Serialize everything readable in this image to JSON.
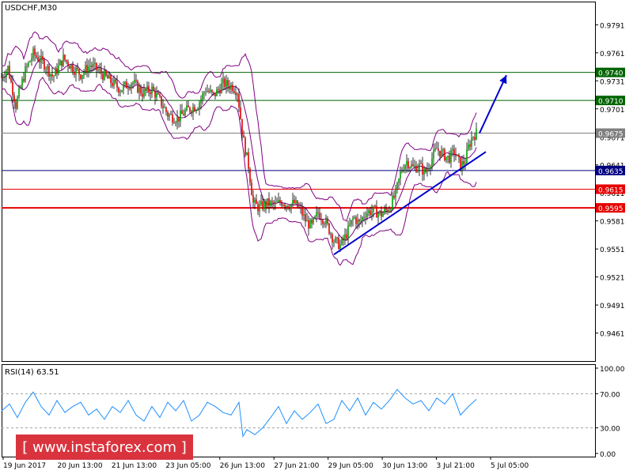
{
  "chart_data": [
    {
      "type": "candlestick",
      "title": "USDCHF,M30",
      "symbol": "USDCHF",
      "timeframe": "M30",
      "ylim": [
        0.9431,
        0.9815
      ],
      "y_ticks": [
        "0.9791",
        "0.9761",
        "0.9731",
        "0.9701",
        "0.9671",
        "0.9641",
        "0.9611",
        "0.9581",
        "0.9551",
        "0.9521",
        "0.9491",
        "0.9461"
      ],
      "x_ticks": [
        "19 Jun 2017",
        "20 Jun 13:00",
        "21 Jun 13:00",
        "23 Jun 05:00",
        "26 Jun 13:00",
        "27 Jun 21:00",
        "29 Jun 05:00",
        "30 Jun 13:00",
        "3 Jul 21:00",
        "5 Jul 05:00"
      ],
      "overlays": [
        "Bollinger Bands"
      ],
      "price_path": [
        [
          0,
          0.9735
        ],
        [
          8,
          0.9745
        ],
        [
          18,
          0.9705
        ],
        [
          30,
          0.9742
        ],
        [
          40,
          0.976
        ],
        [
          55,
          0.9748
        ],
        [
          65,
          0.9735
        ],
        [
          78,
          0.9755
        ],
        [
          90,
          0.9745
        ],
        [
          100,
          0.9738
        ],
        [
          112,
          0.9748
        ],
        [
          125,
          0.974
        ],
        [
          138,
          0.973
        ],
        [
          150,
          0.9722
        ],
        [
          165,
          0.973
        ],
        [
          178,
          0.9718
        ],
        [
          190,
          0.9722
        ],
        [
          200,
          0.971
        ],
        [
          210,
          0.9695
        ],
        [
          222,
          0.969
        ],
        [
          235,
          0.97
        ],
        [
          248,
          0.9705
        ],
        [
          258,
          0.9722
        ],
        [
          268,
          0.9715
        ],
        [
          280,
          0.9728
        ],
        [
          292,
          0.9725
        ],
        [
          298,
          0.972
        ],
        [
          305,
          0.967
        ],
        [
          312,
          0.964
        ],
        [
          318,
          0.96
        ],
        [
          325,
          0.9595
        ],
        [
          335,
          0.96
        ],
        [
          345,
          0.9598
        ],
        [
          355,
          0.9602
        ],
        [
          362,
          0.9598
        ],
        [
          370,
          0.96
        ],
        [
          378,
          0.9592
        ],
        [
          385,
          0.958
        ],
        [
          392,
          0.9575
        ],
        [
          400,
          0.959
        ],
        [
          408,
          0.9582
        ],
        [
          415,
          0.957
        ],
        [
          420,
          0.956
        ],
        [
          428,
          0.9555
        ],
        [
          435,
          0.9565
        ],
        [
          445,
          0.9585
        ],
        [
          452,
          0.9578
        ],
        [
          460,
          0.959
        ],
        [
          470,
          0.9592
        ],
        [
          480,
          0.9588
        ],
        [
          490,
          0.9595
        ],
        [
          498,
          0.961
        ],
        [
          505,
          0.9635
        ],
        [
          512,
          0.9645
        ],
        [
          520,
          0.9638
        ],
        [
          528,
          0.964
        ],
        [
          535,
          0.9632
        ],
        [
          542,
          0.9645
        ],
        [
          550,
          0.9658
        ],
        [
          558,
          0.9652
        ],
        [
          565,
          0.9648
        ],
        [
          572,
          0.9655
        ],
        [
          580,
          0.964
        ],
        [
          586,
          0.9645
        ],
        [
          590,
          0.966
        ],
        [
          595,
          0.9672
        ],
        [
          600,
          0.9675
        ]
      ],
      "levels": [
        {
          "value": 0.974,
          "label": "0.9740",
          "color": "#006400",
          "style": "solid"
        },
        {
          "value": 0.971,
          "label": "0.9710",
          "color": "#006400",
          "style": "solid"
        },
        {
          "value": 0.9675,
          "label": "0.9675",
          "color": "#808080",
          "style": "solid"
        },
        {
          "value": 0.9635,
          "label": "0.9635",
          "color": "#000080",
          "style": "solid"
        },
        {
          "value": 0.9615,
          "label": "0.9615",
          "color": "#e60000",
          "style": "thin"
        },
        {
          "value": 0.9595,
          "label": "0.9595",
          "color": "#e60000",
          "style": "thick"
        }
      ],
      "trendline": {
        "from": [
          420,
          0.9545
        ],
        "to": [
          612,
          0.9655
        ],
        "color": "#0000cd"
      },
      "arrow": {
        "from": [
          604,
          0.9675
        ],
        "to": [
          638,
          0.9737
        ],
        "color": "#0000cd"
      }
    },
    {
      "type": "line",
      "title": "RSI(14) 63.51",
      "indicator": "RSI",
      "period": 14,
      "current_value": 63.51,
      "ylim": [
        0,
        100
      ],
      "y_ticks": [
        "100.00",
        "70.00",
        "30.00",
        "0.00"
      ],
      "reference_levels": [
        70,
        30
      ],
      "x": [
        0,
        10,
        20,
        30,
        40,
        50,
        60,
        70,
        80,
        90,
        100,
        110,
        120,
        130,
        140,
        150,
        160,
        170,
        180,
        190,
        200,
        210,
        220,
        230,
        240,
        250,
        260,
        270,
        280,
        290,
        300,
        305,
        310,
        320,
        330,
        340,
        350,
        360,
        370,
        380,
        390,
        400,
        410,
        420,
        430,
        440,
        450,
        460,
        470,
        480,
        490,
        500,
        510,
        520,
        530,
        540,
        550,
        560,
        570,
        580,
        590,
        600
      ],
      "values": [
        50,
        58,
        42,
        60,
        72,
        55,
        45,
        62,
        48,
        55,
        60,
        45,
        52,
        40,
        55,
        48,
        62,
        45,
        38,
        55,
        42,
        60,
        50,
        62,
        38,
        45,
        60,
        55,
        48,
        45,
        60,
        20,
        28,
        22,
        30,
        42,
        55,
        35,
        50,
        40,
        48,
        58,
        35,
        40,
        62,
        50,
        65,
        45,
        60,
        52,
        62,
        75,
        65,
        58,
        62,
        50,
        65,
        58,
        70,
        45,
        55,
        63.51
      ],
      "color": "#1e90ff"
    }
  ],
  "watermark": {
    "text": "[ www.instaforex.com ]",
    "color": "#d9343e"
  }
}
